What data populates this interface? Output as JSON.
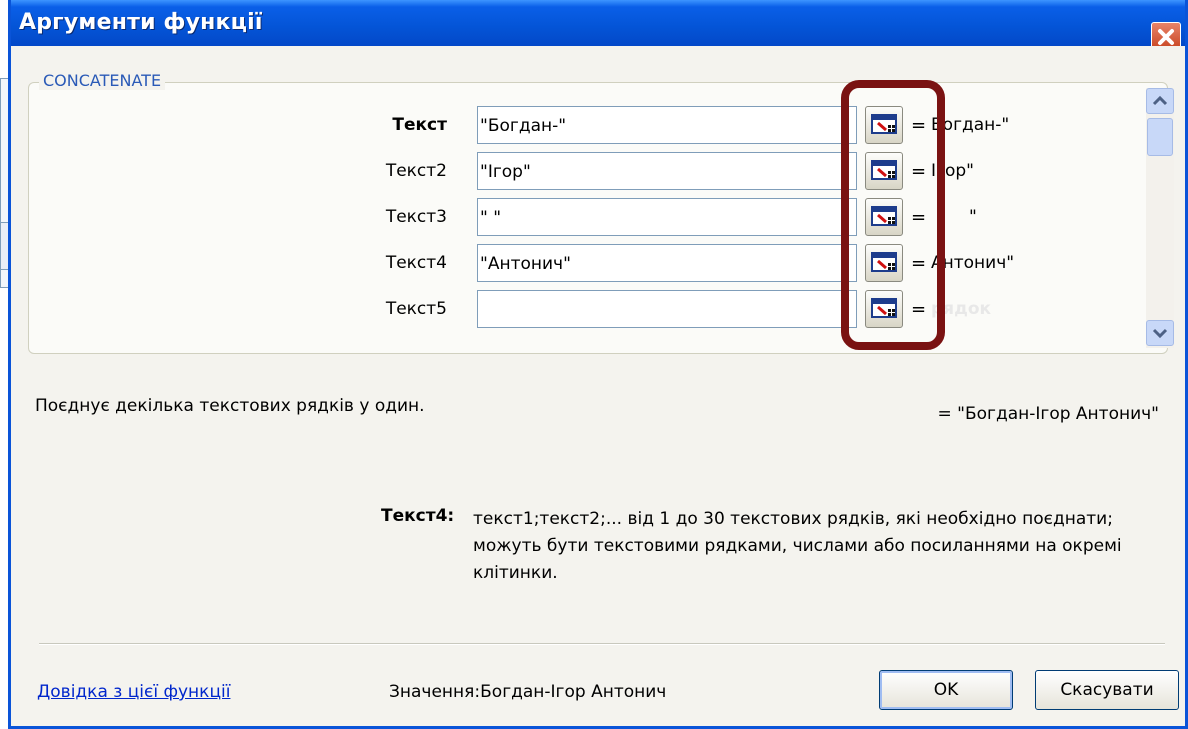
{
  "dialog": {
    "title": "Аргументи функції",
    "function_name": "CONCATENATE"
  },
  "args": [
    {
      "label": "Текст",
      "value": "\"Богдан-\"",
      "result": "Богдан-\""
    },
    {
      "label": "Текст2",
      "value": "\"Ігор\"",
      "result": "Ігор\""
    },
    {
      "label": "Текст3",
      "value": "\" \"",
      "result": "\""
    },
    {
      "label": "Текст4",
      "value": "\"Антонич\"",
      "result": "Антонич\""
    },
    {
      "label": "Текст5",
      "value": "",
      "result": "рядок"
    }
  ],
  "equals_sign": "=",
  "total_result": "= \"Богдан-Ігор Антонич\"",
  "description": "Поєднує декілька текстових рядків у один.",
  "help": {
    "label": "Текст4:",
    "text": "текст1;текст2;... від 1 до 30 текстових рядків, які необхідно поєднати; можуть бути текстовими рядками, числами або посиланнями на окремі клітинки."
  },
  "footer": {
    "help_link": "Довідка з цієї функції",
    "value_label": "Значення:",
    "value": "Богдан-Ігор Антонич",
    "ok_label": "OK",
    "cancel_label": "Скасувати"
  },
  "colors": {
    "title_bar": "#0454d6",
    "highlight": "#7a1212",
    "link": "#0026cc"
  }
}
